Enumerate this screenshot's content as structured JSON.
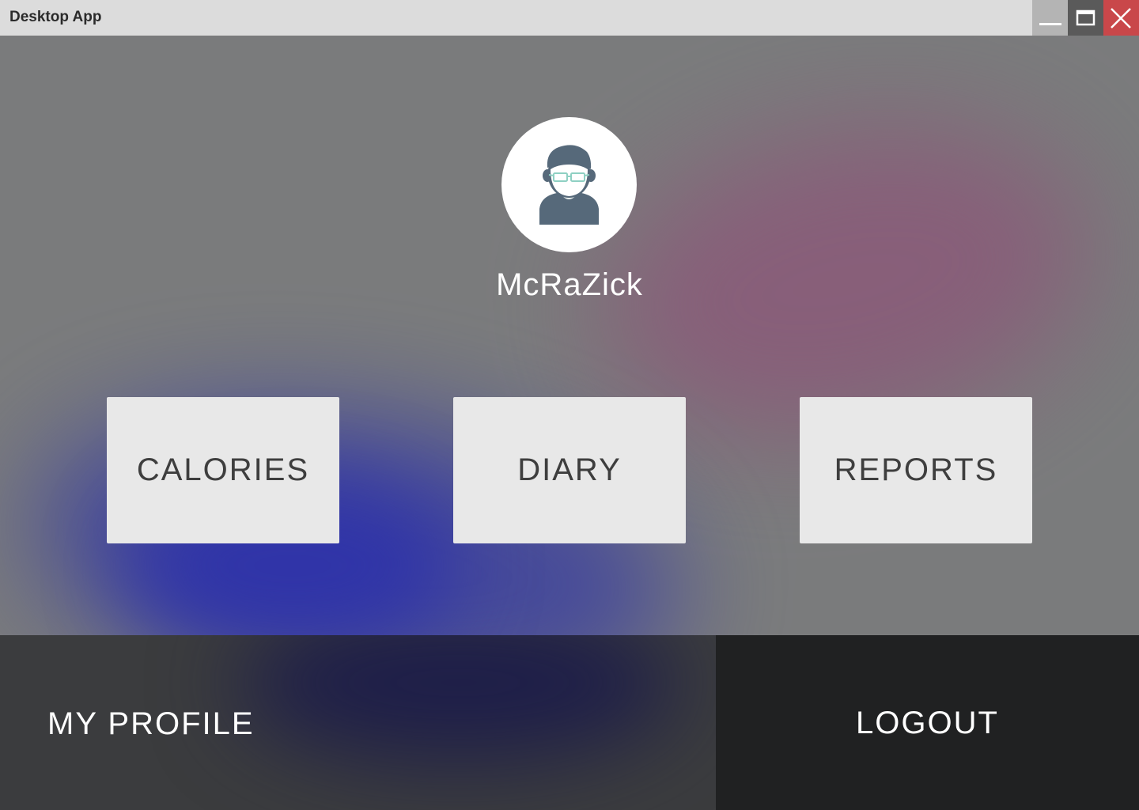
{
  "window": {
    "title": "Desktop App",
    "controls": {
      "minimize_icon": "minimize-icon",
      "maximize_icon": "maximize-icon",
      "close_icon": "close-icon"
    }
  },
  "user": {
    "name": "McRaZick",
    "avatar_icon": "user-avatar-icon"
  },
  "tiles": [
    {
      "label": "CALORIES"
    },
    {
      "label": "DIARY"
    },
    {
      "label": "REPORTS"
    }
  ],
  "footer": {
    "profile_label": "MY PROFILE",
    "logout_label": "LOGOUT"
  },
  "colors": {
    "titlebar": "#dcdcdc",
    "close_button": "#c9474a",
    "tile": "#e8e8e8",
    "logout_panel": "#202122",
    "profile_panel": "#3b3c3e"
  }
}
